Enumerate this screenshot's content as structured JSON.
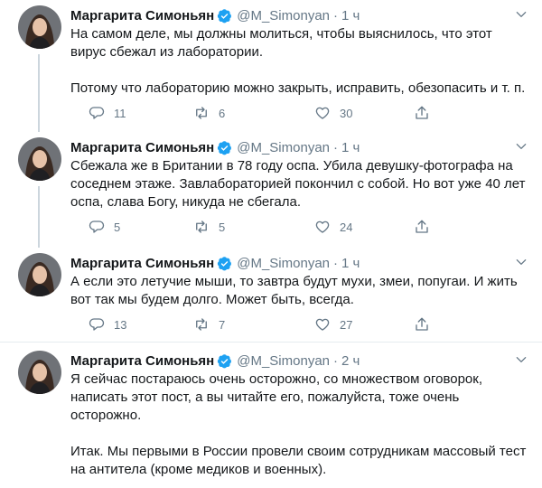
{
  "author": {
    "name": "Маргарита Симоньян",
    "handle": "@M_Simonyan"
  },
  "separator": "·",
  "colors": {
    "verified": "#1da1f2",
    "secondary_text": "#657786",
    "thread_line": "#ccd6dd",
    "divider": "#e6ecf0"
  },
  "tweets": [
    {
      "time": "1 ч",
      "paragraphs": [
        "На самом деле, мы должны молиться, чтобы выяснилось, что этот вирус сбежал из лаборатории.",
        "Потому что лабораторию можно закрыть, исправить, обезопасить и т. п."
      ],
      "replies": "11",
      "retweets": "6",
      "likes": "30"
    },
    {
      "time": "1 ч",
      "paragraphs": [
        "Сбежала же в Британии в 78 году оспа. Убила девушку-фотографа на соседнем этаже. Завлабораторией покончил с собой. Но вот уже 40 лет оспа, слава Богу, никуда не сбегала."
      ],
      "replies": "5",
      "retweets": "5",
      "likes": "24"
    },
    {
      "time": "1 ч",
      "paragraphs": [
        "А если это летучие мыши, то завтра будут мухи, змеи, попугаи. И жить вот так мы будем долго. Может быть, всегда."
      ],
      "replies": "13",
      "retweets": "7",
      "likes": "27"
    },
    {
      "time": "2 ч",
      "paragraphs": [
        "Я сейчас постараюсь очень осторожно, со множеством оговорок, написать этот пост, а вы читайте его, пожалуйста, тоже очень осторожно.",
        "Итак. Мы первыми в России провели своим сотрудникам массовый тест на антитела (кроме медиков и военных)."
      ]
    }
  ]
}
